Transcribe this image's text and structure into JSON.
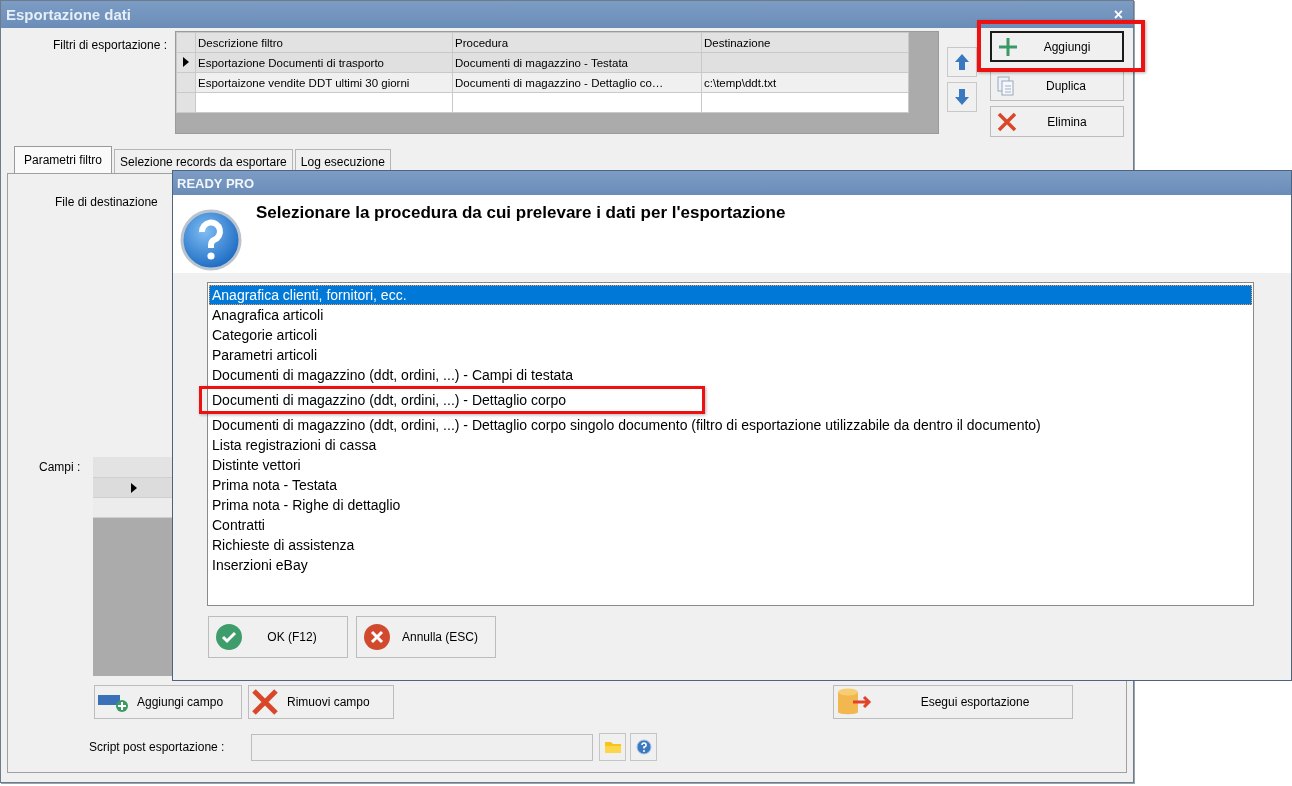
{
  "main_window": {
    "title": "Esportazione dati",
    "close": "×",
    "filters_label": "Filtri di esportazione :",
    "filters_table": {
      "columns": [
        "Descrizione filtro",
        "Procedura",
        "Destinazione"
      ],
      "rows": [
        {
          "cells": [
            "Esportazione Documenti di trasporto",
            "Documenti di magazzino - Testata",
            ""
          ],
          "current": true
        },
        {
          "cells": [
            "Esportaizone vendite DDT ultimi 30 giorni",
            "Documenti di magazzino - Dettaglio co…",
            "c:\\temp\\ddt.txt"
          ],
          "current": false
        }
      ]
    },
    "side_buttons": [
      {
        "label": "Aggiungi",
        "kind": "add",
        "highlighted": true
      },
      {
        "label": "Duplica",
        "kind": "duplicate",
        "highlighted": false
      },
      {
        "label": "Elimina",
        "kind": "delete",
        "highlighted": false
      }
    ],
    "tabs": [
      {
        "label": "Parametri filtro",
        "selected": true
      },
      {
        "label": "Selezione records da esportare",
        "selected": false
      },
      {
        "label": "Log esecuzione",
        "selected": false
      }
    ],
    "destination_label": "File di destinazione",
    "fields_label": "Campi :",
    "fields_grid": {
      "rows": [
        {
          "current": true
        },
        {
          "current": false
        }
      ]
    },
    "field_buttons": [
      {
        "label": "Aggiungi campo",
        "kind": "add-field"
      },
      {
        "label": "Rimuovi campo",
        "kind": "remove-field"
      }
    ],
    "export_button": {
      "label": "Esegui esportazione"
    },
    "script_label": "Script post esportazione :"
  },
  "dialog": {
    "title": "READY PRO",
    "message": "Selezionare la procedura da cui prelevare i dati per l'esportazione",
    "items": [
      {
        "label": "Anagrafica clienti, fornitori, ecc.",
        "selected": true,
        "highlighted": false
      },
      {
        "label": "Anagrafica articoli",
        "selected": false,
        "highlighted": false
      },
      {
        "label": "Categorie articoli",
        "selected": false,
        "highlighted": false
      },
      {
        "label": "Parametri articoli",
        "selected": false,
        "highlighted": false
      },
      {
        "label": "Documenti di magazzino (ddt, ordini, ...) - Campi di testata",
        "selected": false,
        "highlighted": false
      },
      {
        "label": "Documenti di magazzino (ddt, ordini, ...) - Dettaglio corpo",
        "selected": false,
        "highlighted": true
      },
      {
        "label": "Documenti di magazzino (ddt, ordini, ...) - Dettaglio corpo singolo documento (filtro di esportazione utilizzabile da dentro il documento)",
        "selected": false,
        "highlighted": false
      },
      {
        "label": "Lista registrazioni di cassa",
        "selected": false,
        "highlighted": false
      },
      {
        "label": "Distinte vettori",
        "selected": false,
        "highlighted": false
      },
      {
        "label": "Prima nota - Testata",
        "selected": false,
        "highlighted": false
      },
      {
        "label": "Prima nota - Righe di dettaglio",
        "selected": false,
        "highlighted": false
      },
      {
        "label": "Contratti",
        "selected": false,
        "highlighted": false
      },
      {
        "label": "Richieste di assistenza",
        "selected": false,
        "highlighted": false
      },
      {
        "label": "Inserzioni eBay",
        "selected": false,
        "highlighted": false
      }
    ],
    "buttons": [
      {
        "label": "OK (F12)",
        "kind": "ok"
      },
      {
        "label": "Annulla (ESC)",
        "kind": "cancel"
      }
    ]
  }
}
